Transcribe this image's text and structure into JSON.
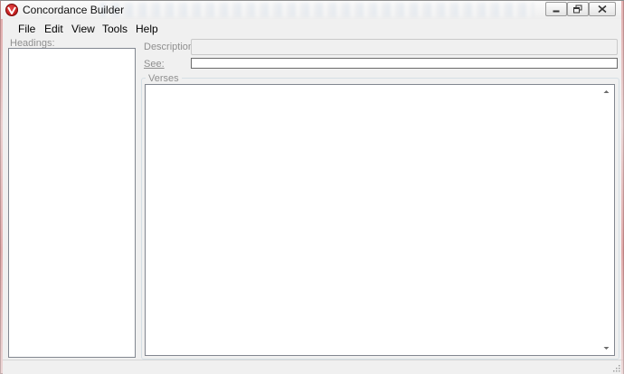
{
  "window": {
    "title": "Concordance Builder"
  },
  "menu": {
    "items": [
      "File",
      "Edit",
      "View",
      "Tools",
      "Help"
    ]
  },
  "headings": {
    "label": "Headings:"
  },
  "description": {
    "label": "Description:",
    "value": ""
  },
  "see": {
    "label": "See:",
    "value": ""
  },
  "verses": {
    "label": "Verses",
    "value": ""
  },
  "colors": {
    "app_icon": "#c41a1a",
    "window_bg": "#f0f0f0",
    "disabled_text": "#8f8f8f"
  },
  "icons": [
    "app-logo-icon",
    "minimize-icon",
    "restore-icon",
    "close-icon",
    "scroll-up-icon",
    "scroll-down-icon",
    "size-grip-icon"
  ]
}
